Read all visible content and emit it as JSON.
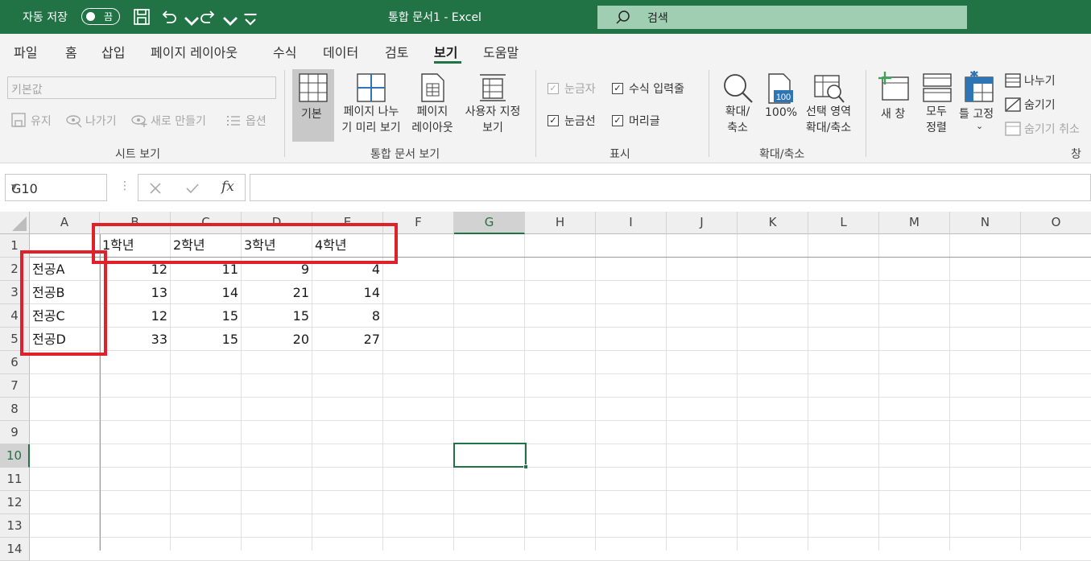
{
  "titlebar": {
    "autosave_label": "자동 저장",
    "autosave_state": "끔",
    "title": "통합 문서1  -  Excel",
    "search_placeholder": "검색"
  },
  "tabs": [
    "파일",
    "홈",
    "삽입",
    "페이지 레이아웃",
    "수식",
    "데이터",
    "검토",
    "보기",
    "도움말"
  ],
  "active_tab": "보기",
  "ribbon": {
    "sheet_view": {
      "dropdown_value": "기본값",
      "keep": "유지",
      "exit": "나가기",
      "new": "새로 만들기",
      "options": "옵션",
      "group_label": "시트 보기"
    },
    "workbook_views": {
      "normal": "기본",
      "page_break_line1": "페이지 나누",
      "page_break_line2": "기 미리 보기",
      "page_layout_line1": "페이지",
      "page_layout_line2": "레이아웃",
      "custom_line1": "사용자 지정",
      "custom_line2": "보기",
      "group_label": "통합 문서 보기"
    },
    "show": {
      "ruler": "눈금자",
      "formula_bar": "수식 입력줄",
      "gridlines": "눈금선",
      "headings": "머리글",
      "group_label": "표시"
    },
    "zoom": {
      "zoom_line1": "확대/",
      "zoom_line2": "축소",
      "zoom100": "100%",
      "zoom100_badge": "100",
      "zoom_sel_line1": "선택 영역",
      "zoom_sel_line2": "확대/축소",
      "group_label": "확대/축소"
    },
    "window": {
      "new_window": "새 창",
      "arrange_line1": "모두",
      "arrange_line2": "정렬",
      "freeze": "틀 고정",
      "split": "나누기",
      "hide": "숨기기",
      "unhide": "숨기기 취소",
      "group_label": "창"
    }
  },
  "formula_bar": {
    "name_box": "G10",
    "fx": "fx",
    "formula": ""
  },
  "columns": [
    "A",
    "B",
    "C",
    "D",
    "E",
    "F",
    "G",
    "H",
    "I",
    "J",
    "K",
    "L",
    "M",
    "N",
    "O"
  ],
  "selected_column": "G",
  "rows": [
    "1",
    "2",
    "3",
    "4",
    "5",
    "6",
    "7",
    "8",
    "9",
    "10",
    "11",
    "12",
    "13",
    "14"
  ],
  "selected_row": "10",
  "sheet": {
    "headers": [
      "1학년",
      "2학년",
      "3학년",
      "4학년"
    ],
    "row_labels": [
      "전공A",
      "전공B",
      "전공C",
      "전공D"
    ],
    "values": [
      [
        "12",
        "11",
        "9",
        "4"
      ],
      [
        "13",
        "14",
        "21",
        "14"
      ],
      [
        "12",
        "15",
        "15",
        "8"
      ],
      [
        "33",
        "15",
        "20",
        "27"
      ]
    ]
  },
  "colors": {
    "accent": "#217346",
    "highlight_box": "#e0202a"
  }
}
